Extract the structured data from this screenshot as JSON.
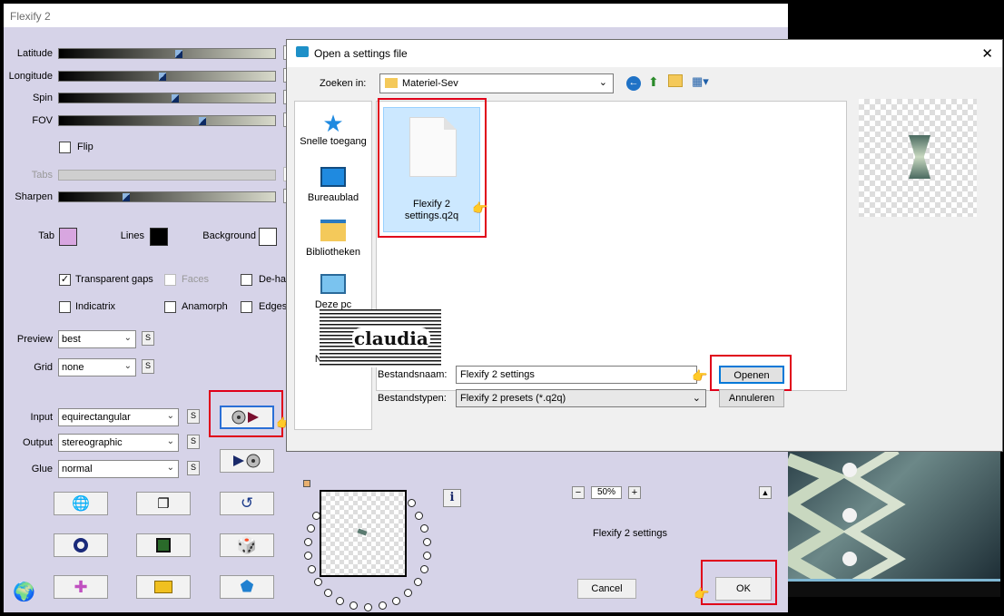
{
  "flexify": {
    "title": "Flexify 2",
    "sliders": [
      {
        "label": "Latitude",
        "value": 0.55
      },
      {
        "label": "Longitude",
        "value": 0.47
      },
      {
        "label": "Spin",
        "value": 0.53
      },
      {
        "label": "FOV",
        "value": 0.65
      }
    ],
    "flip_label": "Flip",
    "tabs_label": "Tabs",
    "sharpen": {
      "label": "Sharpen",
      "value": 0.3
    },
    "colors": {
      "tab_label": "Tab",
      "tab_color": "#d8a6e0",
      "lines_label": "Lines",
      "lines_color": "#000000",
      "background_label": "Background",
      "background_color": "#ffffff"
    },
    "checks": {
      "transparent_gaps": "Transparent gaps",
      "faces": "Faces",
      "dehalo": "De-ha",
      "indicatrix": "Indicatrix",
      "anamorph": "Anamorph",
      "edges": "Edges"
    },
    "preview": {
      "label": "Preview",
      "value": "best"
    },
    "grid": {
      "label": "Grid",
      "value": "none"
    },
    "input": {
      "label": "Input",
      "value": "equirectangular"
    },
    "output": {
      "label": "Output",
      "value": "stereographic"
    },
    "glue": {
      "label": "Glue",
      "value": "normal"
    },
    "s_label": "S",
    "zoom": {
      "value": "50%",
      "minus": "−",
      "plus": "+"
    },
    "settings_name": "Flexify 2 settings",
    "info_label": "i",
    "cancel_label": "Cancel",
    "ok_label": "OK"
  },
  "dialog": {
    "title": "Open a settings file",
    "lookin_label": "Zoeken in:",
    "folder": "Materiel-Sev",
    "places": [
      "Snelle toegang",
      "Bureaublad",
      "Bibliotheken",
      "Deze pc",
      "Netwerk"
    ],
    "file": {
      "name_line1": "Flexify 2",
      "name_line2": "settings.q2q"
    },
    "filename_label": "Bestandsnaam:",
    "filename_value": "Flexify 2 settings",
    "filetype_label": "Bestandstypen:",
    "filetype_value": "Flexify 2 presets (*.q2q)",
    "open_label": "Openen",
    "cancel_label": "Annuleren"
  },
  "watermark_text": "claudia"
}
